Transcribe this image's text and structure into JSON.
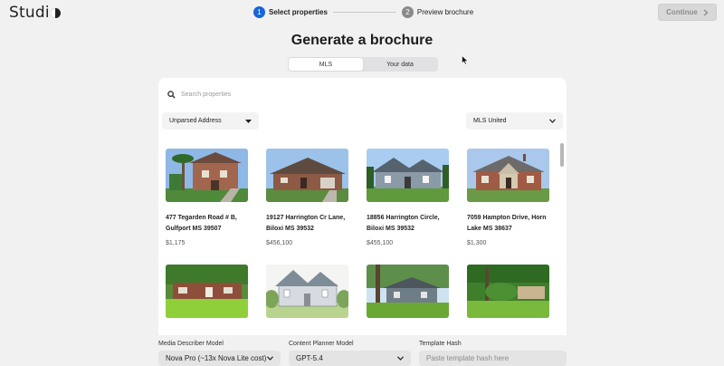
{
  "app": {
    "logo_text": "Studi"
  },
  "steps": [
    {
      "number": "1",
      "label": "Select properties"
    },
    {
      "number": "2",
      "label": "Preview brochure"
    }
  ],
  "header": {
    "continue_label": "Continue"
  },
  "page": {
    "title": "Generate a brochure"
  },
  "toggle": {
    "options": [
      "MLS",
      "Your data"
    ],
    "selected": "MLS"
  },
  "search": {
    "placeholder": "Search properties"
  },
  "filters": {
    "address_select": "Unparsed Address",
    "mls_select": "MLS United"
  },
  "listings": [
    {
      "address": "477 Tegarden Road # B, Gulfport MS 39507",
      "price": "$1,175",
      "image": "house-brick-two-story-palms"
    },
    {
      "address": "19127 Harrington Cr Lane, Biloxi MS 39532",
      "price": "$456,100",
      "image": "house-brick-ranch"
    },
    {
      "address": "18856 Harrington Circle, Biloxi MS 39532",
      "price": "$455,100",
      "image": "house-gray-craftsman"
    },
    {
      "address": "7059 Hampton Drive, Horn Lake MS 38637",
      "price": "$1,300",
      "image": "house-brick-cottage"
    },
    {
      "address": "",
      "price": "",
      "image": "house-brick-ranch-lawn"
    },
    {
      "address": "",
      "price": "",
      "image": "house-sketch-two-story"
    },
    {
      "address": "",
      "price": "",
      "image": "house-gray-trees"
    },
    {
      "address": "",
      "price": "",
      "image": "house-wooded-yard"
    }
  ],
  "bottom": {
    "media_model_label": "Media Describer Model",
    "media_model_value": "Nova Pro (~13x Nova Lite cost)",
    "planner_label": "Content Planner Model",
    "planner_value": "GPT-5.4",
    "hash_label": "Template Hash",
    "hash_placeholder": "Paste template hash here"
  },
  "colors": {
    "accent": "#1565d8",
    "background": "#f1f1f2",
    "card": "#ffffff"
  }
}
